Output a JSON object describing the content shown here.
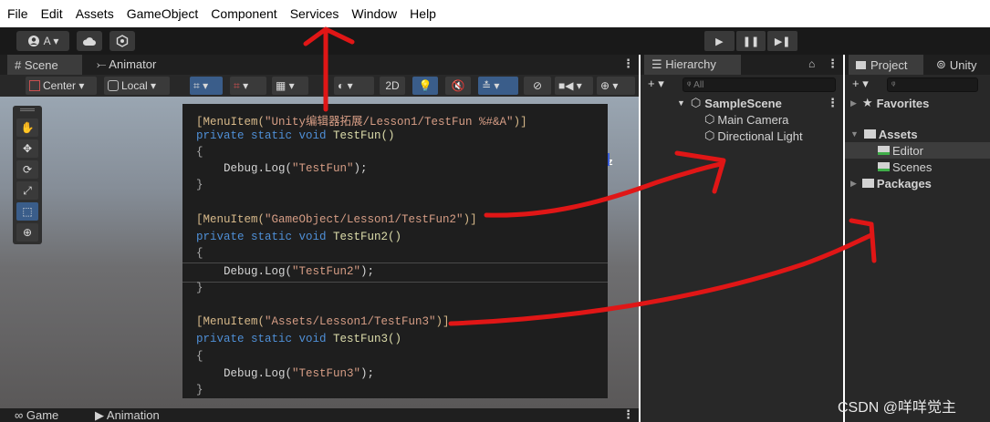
{
  "menu": [
    "File",
    "Edit",
    "Assets",
    "GameObject",
    "Component",
    "Services",
    "Window",
    "Help"
  ],
  "toolbar": {
    "account_label": "A ▾",
    "account_icon": "account-icon",
    "cloud_icon": "cloud-icon",
    "collab_icon": "collab-icon",
    "play_icon": "▶",
    "pause_icon": "❚❚",
    "step_icon": "▶❚"
  },
  "scene_panel": {
    "tabs": [
      "# Scene",
      "⤚ Animator"
    ],
    "pivot_label": "Center ▾",
    "space_label": "Local ▾",
    "mode_2d": "2D",
    "axis_label": "z",
    "tools": [
      "✋",
      "✥",
      "⟳",
      "⤢",
      "⬚",
      "⊕"
    ]
  },
  "bottom_tabs": [
    "∞ Game",
    "▶ Animation"
  ],
  "hierarchy": {
    "tab": "☰ Hierarchy",
    "lock_icon": "🔒",
    "add_label": "+ ▾",
    "search_placeholder": "ᵠ All",
    "scene": "SampleScene",
    "items": [
      "Main Camera",
      "Directional Light"
    ]
  },
  "project": {
    "tabs": [
      "Project",
      "Unity"
    ],
    "add_label": "+ ▾",
    "search_placeholder": "ᵠ",
    "tree": {
      "favorites": "Favorites",
      "assets": "Assets",
      "editor": "Editor",
      "scenes": "Scenes",
      "packages": "Packages"
    }
  },
  "code": {
    "line1_pre": "[MenuItem(",
    "line1_str": "\"Unity编辑器拓展/Lesson1/TestFun %#&A\"",
    "line1_post": ")]",
    "line2_kw": "private static void ",
    "line2_fn": "TestFun()",
    "line3": "{",
    "line4_pre": "    Debug.Log(",
    "line4_str": "\"TestFun\"",
    "line4_post": ");",
    "line5": "}",
    "line6_pre": "[MenuItem(",
    "line6_str": "\"GameObject/Lesson1/TestFun2\"",
    "line6_post": ")]",
    "line7_kw": "private static void ",
    "line7_fn": "TestFun2()",
    "line8": "{",
    "line9_pre": "    Debug.Log(",
    "line9_str": "\"TestFun2\"",
    "line9_post": ");",
    "line10": "}",
    "line11_pre": "[MenuItem(",
    "line11_str": "\"Assets/Lesson1/TestFun3\"",
    "line11_post": ")]",
    "line12_kw": "private static void ",
    "line12_fn": "TestFun3()",
    "line13": "{",
    "line14_pre": "    Debug.Log(",
    "line14_str": "\"TestFun3\"",
    "line14_post": ");",
    "line15": "}"
  },
  "watermark": "CSDN @咩咩觉主",
  "colors": {
    "annotation_red": "#e01616",
    "selection_blue": "#3a5d8a",
    "panel_bg": "#282828"
  }
}
